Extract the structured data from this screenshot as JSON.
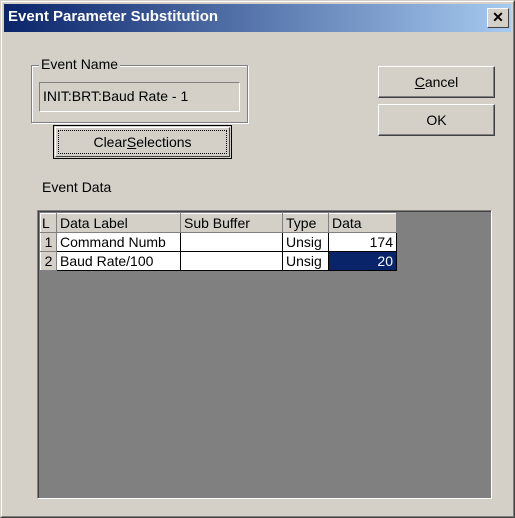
{
  "window": {
    "title": "Event Parameter Substitution",
    "close_glyph": "✕"
  },
  "event_name": {
    "group_label": "Event Name",
    "value": "INIT:BRT:Baud Rate - 1"
  },
  "buttons": {
    "clear_pre": "Clear ",
    "clear_ul": "S",
    "clear_post": "elections",
    "cancel_ul": "C",
    "cancel_post": "ancel",
    "ok": "OK"
  },
  "event_data": {
    "label": "Event Data"
  },
  "grid": {
    "columns": [
      "L",
      "Data Label",
      "Sub Buffer",
      "Type",
      "Data"
    ],
    "rows": [
      {
        "index": "1",
        "label": "Command Numb",
        "sub_buffer": "",
        "type": "Unsig",
        "data": "174"
      },
      {
        "index": "2",
        "label": "Baud Rate/100",
        "sub_buffer": "",
        "type": "Unsig",
        "data": "20"
      }
    ],
    "selected_cell": "row 2, Data"
  },
  "colors": {
    "titlebar_start": "#0a246a",
    "titlebar_end": "#a6caf0",
    "face": "#d4d0c8",
    "selection": "#0a246a",
    "grid_bg": "#808080"
  }
}
